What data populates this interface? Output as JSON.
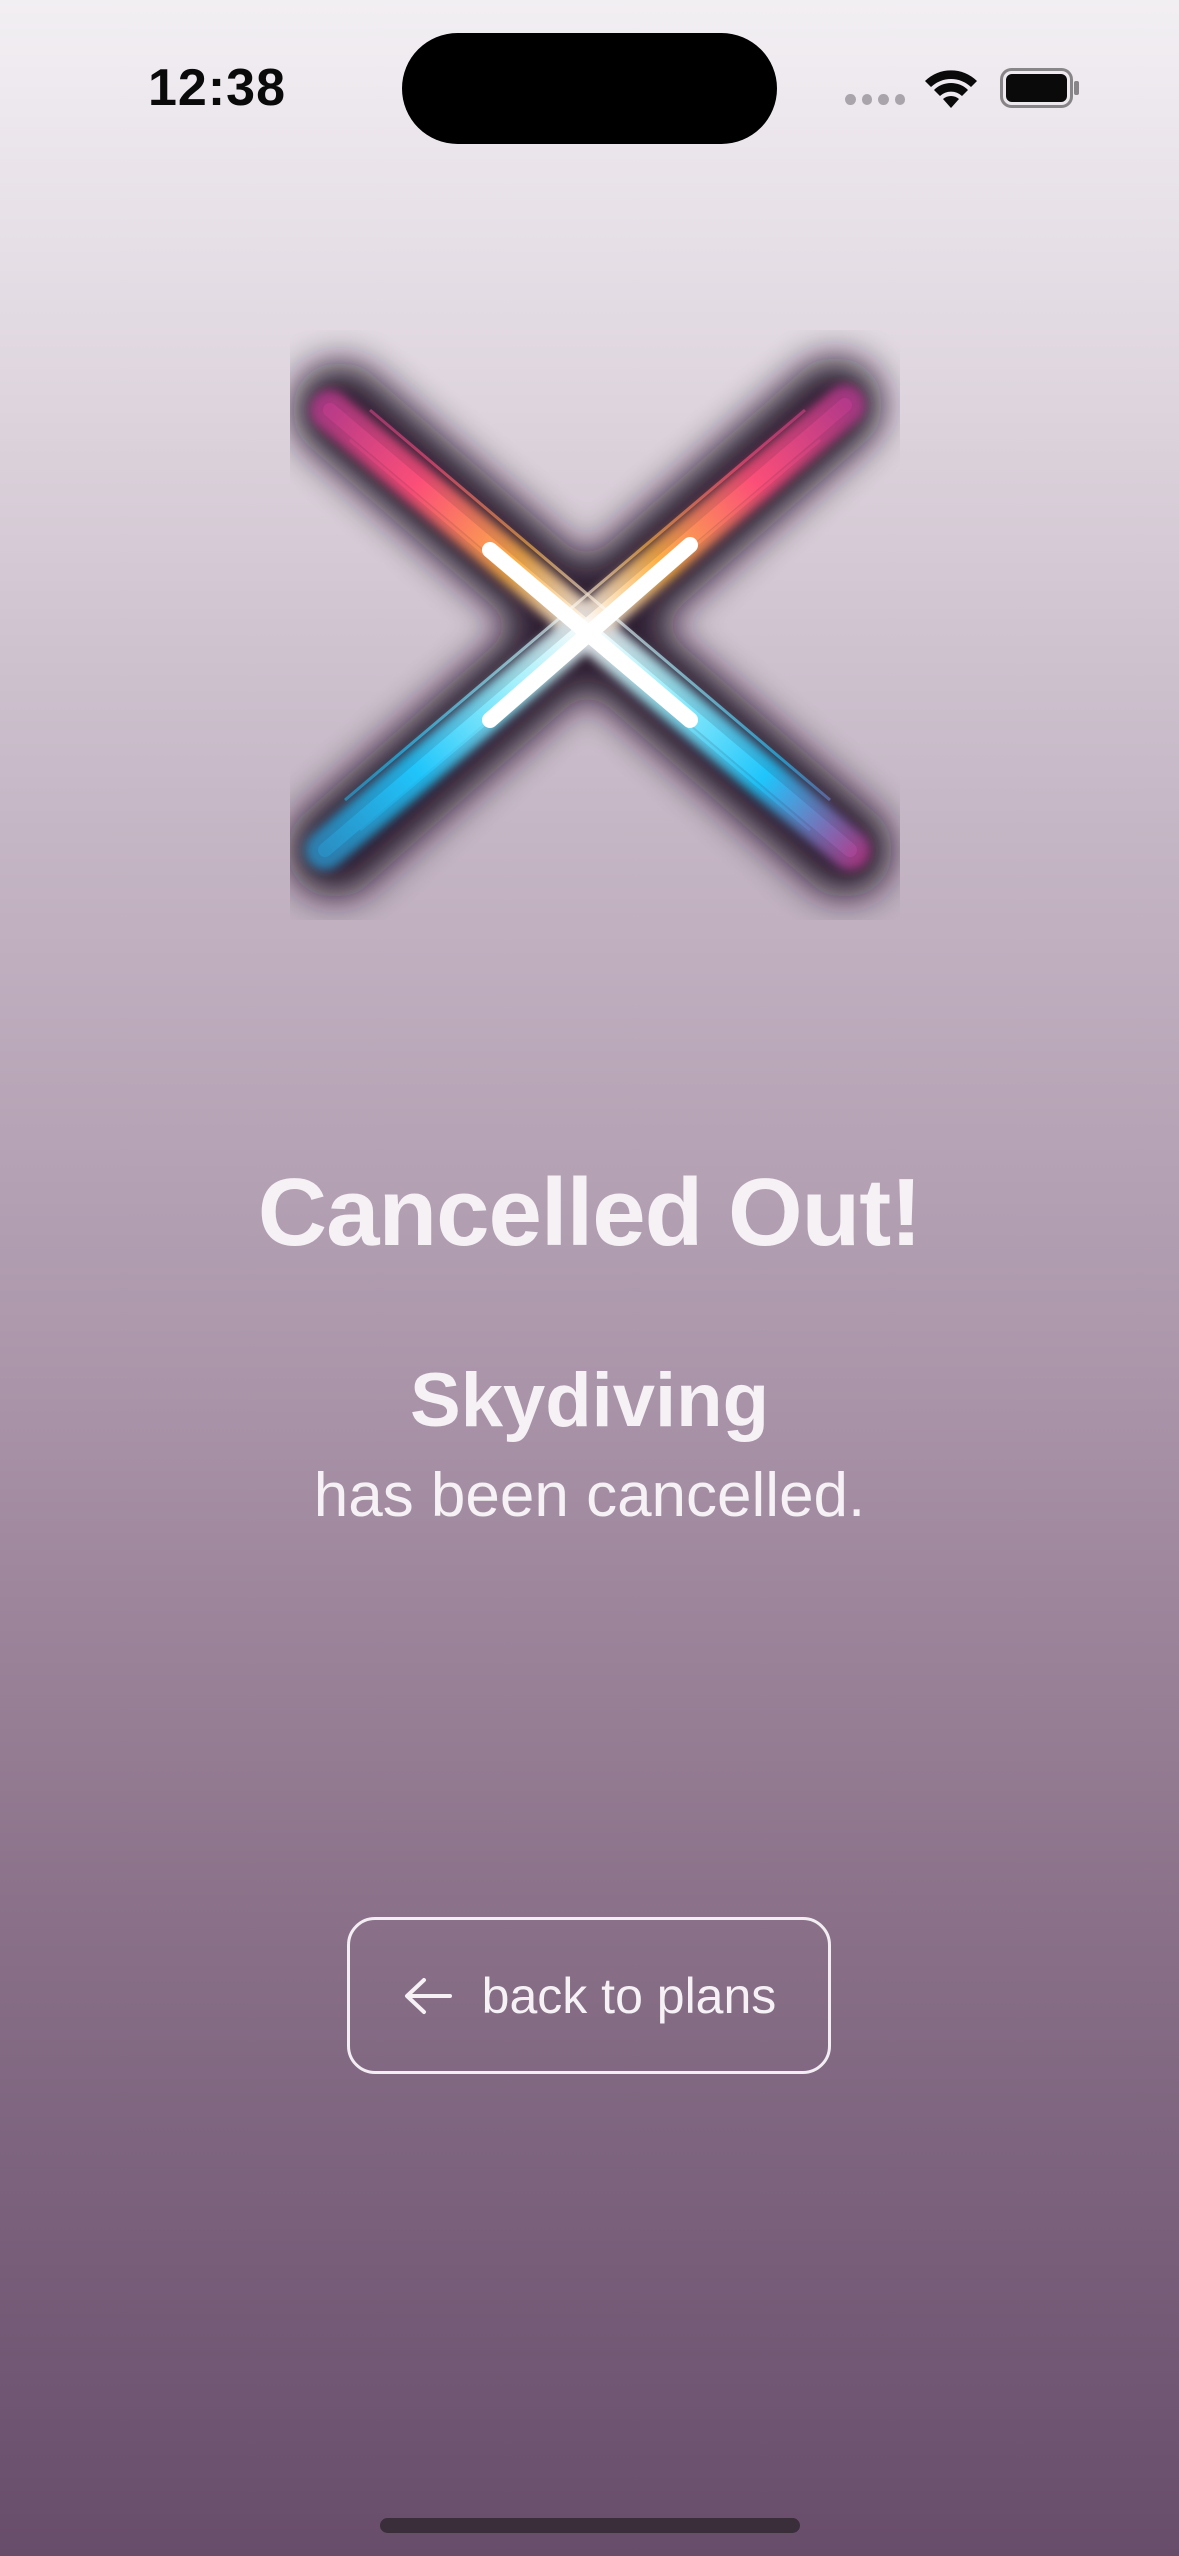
{
  "status_bar": {
    "time": "12:38"
  },
  "main": {
    "title": "Cancelled Out!",
    "activity_name": "Skydiving",
    "message": "has been cancelled."
  },
  "actions": {
    "back_label": "back to plans"
  },
  "colors": {
    "text": "#f5f1f5",
    "background_top": "#f2eff3",
    "background_bottom": "#684d6b"
  },
  "icons": {
    "hero": "cancelled-x-icon",
    "back": "arrow-left-icon",
    "wifi": "wifi-icon",
    "battery": "battery-icon"
  }
}
